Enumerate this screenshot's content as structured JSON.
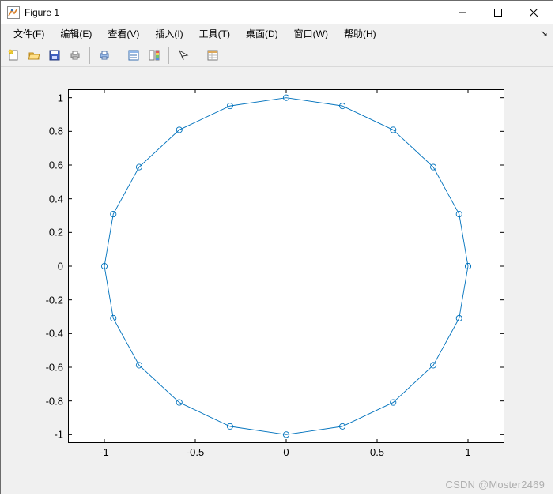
{
  "window": {
    "title": "Figure 1"
  },
  "menu": {
    "file": "文件(F)",
    "edit": "编辑(E)",
    "view": "查看(V)",
    "insert": "插入(I)",
    "tools": "工具(T)",
    "desktop": "桌面(D)",
    "window": "窗口(W)",
    "help": "帮助(H)"
  },
  "watermark": "CSDN @Moster2469",
  "colors": {
    "line": "#0072BD",
    "axes_bg": "#ffffff",
    "figure_bg": "#f0f0f0"
  },
  "chart_data": {
    "type": "line",
    "title": "",
    "xlabel": "",
    "ylabel": "",
    "xlim": [
      -1.2,
      1.2
    ],
    "ylim": [
      -1.05,
      1.05
    ],
    "xticks": [
      -1,
      -0.5,
      0,
      0.5,
      1
    ],
    "yticks": [
      -1,
      -0.8,
      -0.6,
      -0.4,
      -0.2,
      0,
      0.2,
      0.4,
      0.6,
      0.8,
      1
    ],
    "marker": "o",
    "series": [
      {
        "name": "circle",
        "x": [
          1.0,
          0.951,
          0.809,
          0.588,
          0.309,
          0.0,
          -0.309,
          -0.588,
          -0.809,
          -0.951,
          -1.0,
          -0.951,
          -0.809,
          -0.588,
          -0.309,
          0.0,
          0.309,
          0.588,
          0.809,
          0.951,
          1.0
        ],
        "y": [
          0.0,
          0.309,
          0.588,
          0.809,
          0.951,
          1.0,
          0.951,
          0.809,
          0.588,
          0.309,
          0.0,
          -0.309,
          -0.588,
          -0.809,
          -0.951,
          -1.0,
          -0.951,
          -0.809,
          -0.588,
          -0.309,
          0.0
        ]
      }
    ]
  }
}
